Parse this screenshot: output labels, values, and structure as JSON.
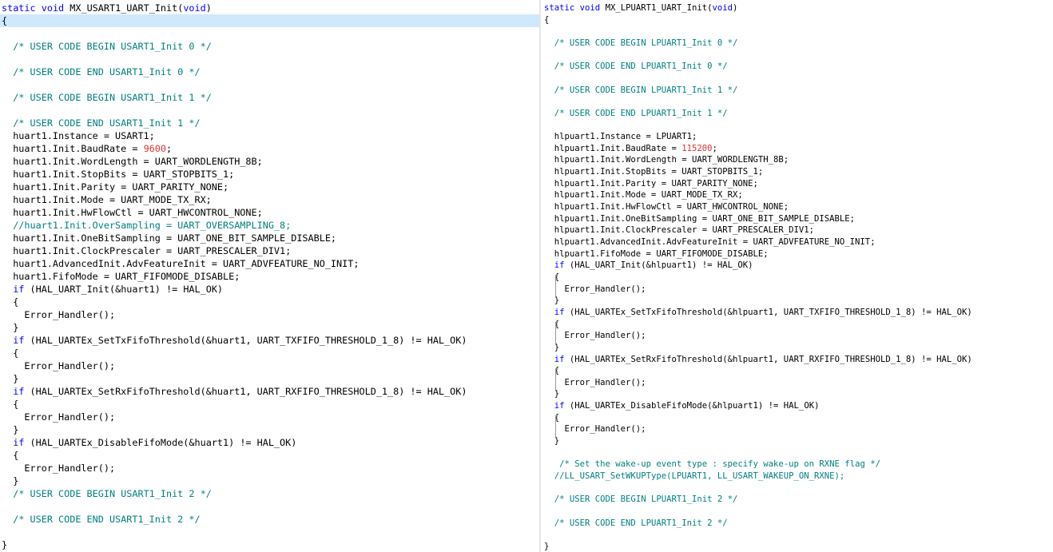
{
  "left_editor": {
    "lines": [
      [
        {
          "k": "kw",
          "t": "static"
        },
        {
          "k": "",
          "t": " "
        },
        {
          "k": "kw",
          "t": "void"
        },
        {
          "k": "",
          "t": " MX_USART1_UART_Init("
        },
        {
          "k": "kw",
          "t": "void"
        },
        {
          "k": "",
          "t": ")"
        }
      ],
      [
        {
          "k": "",
          "t": "{"
        }
      ],
      [],
      [
        {
          "k": "",
          "t": "  "
        },
        {
          "k": "cm",
          "t": "/* USER CODE BEGIN USART1_Init 0 */"
        }
      ],
      [],
      [
        {
          "k": "",
          "t": "  "
        },
        {
          "k": "cm",
          "t": "/* USER CODE END USART1_Init 0 */"
        }
      ],
      [],
      [
        {
          "k": "",
          "t": "  "
        },
        {
          "k": "cm",
          "t": "/* USER CODE BEGIN USART1_Init 1 */"
        }
      ],
      [],
      [
        {
          "k": "",
          "t": "  "
        },
        {
          "k": "cm",
          "t": "/* USER CODE END USART1_Init 1 */"
        }
      ],
      [
        {
          "k": "",
          "t": "  huart1.Instance = USART1;"
        }
      ],
      [
        {
          "k": "",
          "t": "  huart1.Init.BaudRate = "
        },
        {
          "k": "num",
          "t": "9600"
        },
        {
          "k": "",
          "t": ";"
        }
      ],
      [
        {
          "k": "",
          "t": "  huart1.Init.WordLength = UART_WORDLENGTH_8B;"
        }
      ],
      [
        {
          "k": "",
          "t": "  huart1.Init.StopBits = UART_STOPBITS_1;"
        }
      ],
      [
        {
          "k": "",
          "t": "  huart1.Init.Parity = UART_PARITY_NONE;"
        }
      ],
      [
        {
          "k": "",
          "t": "  huart1.Init.Mode = UART_MODE_TX_RX;"
        }
      ],
      [
        {
          "k": "",
          "t": "  huart1.Init.HwFlowCtl = UART_HWCONTROL_NONE;"
        }
      ],
      [
        {
          "k": "",
          "t": "  "
        },
        {
          "k": "cm",
          "t": "//huart1.Init.OverSampling = UART_OVERSAMPLING_8;"
        }
      ],
      [
        {
          "k": "",
          "t": "  huart1.Init.OneBitSampling = UART_ONE_BIT_SAMPLE_DISABLE;"
        }
      ],
      [
        {
          "k": "",
          "t": "  huart1.Init.ClockPrescaler = UART_PRESCALER_DIV1;"
        }
      ],
      [
        {
          "k": "",
          "t": "  huart1.AdvancedInit.AdvFeatureInit = UART_ADVFEATURE_NO_INIT;"
        }
      ],
      [
        {
          "k": "",
          "t": "  huart1.FifoMode = UART_FIFOMODE_DISABLE;"
        }
      ],
      [
        {
          "k": "",
          "t": "  "
        },
        {
          "k": "kw",
          "t": "if"
        },
        {
          "k": "",
          "t": " (HAL_UART_Init("
        },
        {
          "k": "op",
          "t": "&"
        },
        {
          "k": "",
          "t": "huart1) != HAL_OK)"
        }
      ],
      [
        {
          "k": "",
          "t": "  {"
        }
      ],
      [
        {
          "k": "",
          "t": "    Error_Handler();"
        }
      ],
      [
        {
          "k": "",
          "t": "  }"
        }
      ],
      [
        {
          "k": "",
          "t": "  "
        },
        {
          "k": "kw",
          "t": "if"
        },
        {
          "k": "",
          "t": " (HAL_UARTEx_SetTxFifoThreshold("
        },
        {
          "k": "op",
          "t": "&"
        },
        {
          "k": "",
          "t": "huart1, UART_TXFIFO_THRESHOLD_1_8) != HAL_OK)"
        }
      ],
      [
        {
          "k": "",
          "t": "  {"
        }
      ],
      [
        {
          "k": "",
          "t": "    Error_Handler();"
        }
      ],
      [
        {
          "k": "",
          "t": "  }"
        }
      ],
      [
        {
          "k": "",
          "t": "  "
        },
        {
          "k": "kw",
          "t": "if"
        },
        {
          "k": "",
          "t": " (HAL_UARTEx_SetRxFifoThreshold("
        },
        {
          "k": "op",
          "t": "&"
        },
        {
          "k": "",
          "t": "huart1, UART_RXFIFO_THRESHOLD_1_8) != HAL_OK)"
        }
      ],
      [
        {
          "k": "",
          "t": "  {"
        }
      ],
      [
        {
          "k": "",
          "t": "    Error_Handler();"
        }
      ],
      [
        {
          "k": "",
          "t": "  }"
        }
      ],
      [
        {
          "k": "",
          "t": "  "
        },
        {
          "k": "kw",
          "t": "if"
        },
        {
          "k": "",
          "t": " (HAL_UARTEx_DisableFifoMode("
        },
        {
          "k": "op",
          "t": "&"
        },
        {
          "k": "",
          "t": "huart1) != HAL_OK)"
        }
      ],
      [
        {
          "k": "",
          "t": "  {"
        }
      ],
      [
        {
          "k": "",
          "t": "    Error_Handler();"
        }
      ],
      [
        {
          "k": "",
          "t": "  }"
        }
      ],
      [
        {
          "k": "",
          "t": "  "
        },
        {
          "k": "cm",
          "t": "/* USER CODE BEGIN USART1_Init 2 */"
        }
      ],
      [],
      [
        {
          "k": "",
          "t": "  "
        },
        {
          "k": "cm",
          "t": "/* USER CODE END USART1_Init 2 */"
        }
      ],
      [],
      [
        {
          "k": "",
          "t": "}"
        }
      ]
    ]
  },
  "right_editor": {
    "lines": [
      [
        {
          "k": "kw",
          "t": "static"
        },
        {
          "k": "",
          "t": " "
        },
        {
          "k": "kw",
          "t": "void"
        },
        {
          "k": "",
          "t": " MX_LPUART1_UART_Init("
        },
        {
          "k": "kw",
          "t": "void"
        },
        {
          "k": "",
          "t": ")"
        }
      ],
      [
        {
          "k": "",
          "t": "{"
        }
      ],
      [],
      [
        {
          "k": "",
          "t": "  "
        },
        {
          "k": "cm",
          "t": "/* USER CODE BEGIN LPUART1_Init 0 */"
        }
      ],
      [],
      [
        {
          "k": "",
          "t": "  "
        },
        {
          "k": "cm",
          "t": "/* USER CODE END LPUART1_Init 0 */"
        }
      ],
      [],
      [
        {
          "k": "",
          "t": "  "
        },
        {
          "k": "cm",
          "t": "/* USER CODE BEGIN LPUART1_Init 1 */"
        }
      ],
      [],
      [
        {
          "k": "",
          "t": "  "
        },
        {
          "k": "cm",
          "t": "/* USER CODE END LPUART1_Init 1 */"
        }
      ],
      [],
      [
        {
          "k": "",
          "t": "  hlpuart1.Instance = LPUART1;"
        }
      ],
      [
        {
          "k": "",
          "t": "  hlpuart1.Init.BaudRate = "
        },
        {
          "k": "num",
          "t": "115200"
        },
        {
          "k": "",
          "t": ";"
        }
      ],
      [
        {
          "k": "",
          "t": "  hlpuart1.Init.WordLength = UART_WORDLENGTH_8B;"
        }
      ],
      [
        {
          "k": "",
          "t": "  hlpuart1.Init.StopBits = UART_STOPBITS_1;"
        }
      ],
      [
        {
          "k": "",
          "t": "  hlpuart1.Init.Parity = UART_PARITY_NONE;"
        }
      ],
      [
        {
          "k": "",
          "t": "  hlpuart1.Init.Mode = UART_MODE_TX_RX;"
        }
      ],
      [
        {
          "k": "",
          "t": "  hlpuart1.Init.HwFlowCtl = UART_HWCONTROL_NONE;"
        }
      ],
      [
        {
          "k": "",
          "t": "  hlpuart1.Init.OneBitSampling = UART_ONE_BIT_SAMPLE_DISABLE;"
        }
      ],
      [
        {
          "k": "",
          "t": "  hlpuart1.Init.ClockPrescaler = UART_PRESCALER_DIV1;"
        }
      ],
      [
        {
          "k": "",
          "t": "  hlpuart1.AdvancedInit.AdvFeatureInit = UART_ADVFEATURE_NO_INIT;"
        }
      ],
      [
        {
          "k": "",
          "t": "  hlpuart1.FifoMode = UART_FIFOMODE_DISABLE;"
        }
      ],
      [
        {
          "k": "",
          "t": "  "
        },
        {
          "k": "kw",
          "t": "if"
        },
        {
          "k": "",
          "t": " (HAL_UART_Init("
        },
        {
          "k": "op",
          "t": "&"
        },
        {
          "k": "",
          "t": "hlpuart1) != HAL_OK)"
        }
      ],
      [
        {
          "k": "",
          "t": "  {"
        }
      ],
      [
        {
          "k": "",
          "t": "    Error_Handler();"
        }
      ],
      [
        {
          "k": "",
          "t": "  }"
        }
      ],
      [
        {
          "k": "",
          "t": "  "
        },
        {
          "k": "kw",
          "t": "if"
        },
        {
          "k": "",
          "t": " (HAL_UARTEx_SetTxFifoThreshold("
        },
        {
          "k": "op",
          "t": "&"
        },
        {
          "k": "",
          "t": "hlpuart1, UART_TXFIFO_THRESHOLD_1_8) != HAL_OK)"
        }
      ],
      [
        {
          "k": "",
          "t": "  {"
        }
      ],
      [
        {
          "k": "",
          "t": "    Error_Handler();"
        }
      ],
      [
        {
          "k": "",
          "t": "  }"
        }
      ],
      [
        {
          "k": "",
          "t": "  "
        },
        {
          "k": "kw",
          "t": "if"
        },
        {
          "k": "",
          "t": " (HAL_UARTEx_SetRxFifoThreshold("
        },
        {
          "k": "op",
          "t": "&"
        },
        {
          "k": "",
          "t": "hlpuart1, UART_RXFIFO_THRESHOLD_1_8) != HAL_OK)"
        }
      ],
      [
        {
          "k": "",
          "t": "  {"
        }
      ],
      [
        {
          "k": "",
          "t": "    Error_Handler();"
        }
      ],
      [
        {
          "k": "",
          "t": "  }"
        }
      ],
      [
        {
          "k": "",
          "t": "  "
        },
        {
          "k": "kw",
          "t": "if"
        },
        {
          "k": "",
          "t": " (HAL_UARTEx_DisableFifoMode("
        },
        {
          "k": "op",
          "t": "&"
        },
        {
          "k": "",
          "t": "hlpuart1) != HAL_OK)"
        }
      ],
      [
        {
          "k": "",
          "t": "  {"
        }
      ],
      [
        {
          "k": "",
          "t": "    Error_Handler();"
        }
      ],
      [
        {
          "k": "",
          "t": "  }"
        }
      ],
      [],
      [
        {
          "k": "",
          "t": "   "
        },
        {
          "k": "cm",
          "t": "/* Set the wake-up event type : specify wake-up on RXNE flag */"
        }
      ],
      [
        {
          "k": "",
          "t": "  "
        },
        {
          "k": "cm",
          "t": "//LL_USART_SetWKUPType(LPUART1, LL_USART_WAKEUP_ON_RXNE);"
        }
      ],
      [],
      [
        {
          "k": "",
          "t": "  "
        },
        {
          "k": "cm",
          "t": "/* USER CODE BEGIN LPUART1_Init 2 */"
        }
      ],
      [],
      [
        {
          "k": "",
          "t": "  "
        },
        {
          "k": "cm",
          "t": "/* USER CODE END LPUART1_Init 2 */"
        }
      ],
      [],
      [
        {
          "k": "",
          "t": "}"
        }
      ]
    ]
  }
}
